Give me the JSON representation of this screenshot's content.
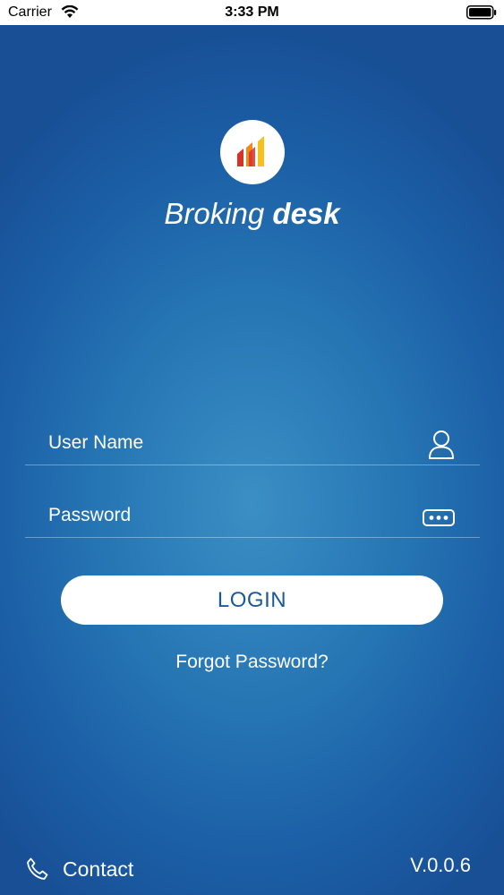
{
  "status_bar": {
    "carrier": "Carrier",
    "time": "3:33 PM",
    "wifi_icon": "wifi-icon",
    "battery_icon": "battery-icon"
  },
  "brand": {
    "logo_icon": "bar-chart-logo-icon",
    "name_light": "Broking",
    "name_bold": "desk"
  },
  "form": {
    "username": {
      "value": "",
      "placeholder": "User Name",
      "icon": "user-icon"
    },
    "password": {
      "value": "",
      "placeholder": "Password",
      "icon": "password-dots-icon"
    },
    "login_label": "LOGIN",
    "forgot_label": "Forgot Password?"
  },
  "footer": {
    "contact_label": "Contact",
    "contact_icon": "phone-icon",
    "version": "V.0.0.6"
  },
  "colors": {
    "background_center": "#3a8fc4",
    "background_edge": "#184f95",
    "login_text": "#1b5a98",
    "logo_red": "#d8312a",
    "logo_orange": "#f08a1c",
    "logo_yellow": "#f4c21a"
  }
}
